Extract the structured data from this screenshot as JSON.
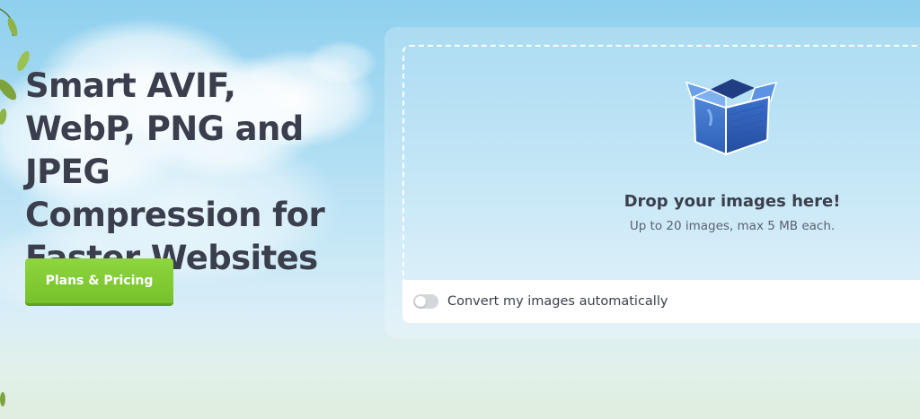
{
  "hero": {
    "headline": "Smart AVIF, WebP, PNG and JPEG Compression for Faster Websites",
    "cta_label": "Plans & Pricing"
  },
  "upload": {
    "title": "Drop your images here!",
    "subtitle": "Up to 20 images, max 5 MB each.",
    "icon": "box-icon"
  },
  "options": {
    "convert_label": "Convert my images automatically",
    "convert_enabled": false
  },
  "colors": {
    "cta": "#7fcb32",
    "text": "#3b3f4d",
    "sky": "#8fd0ee"
  }
}
